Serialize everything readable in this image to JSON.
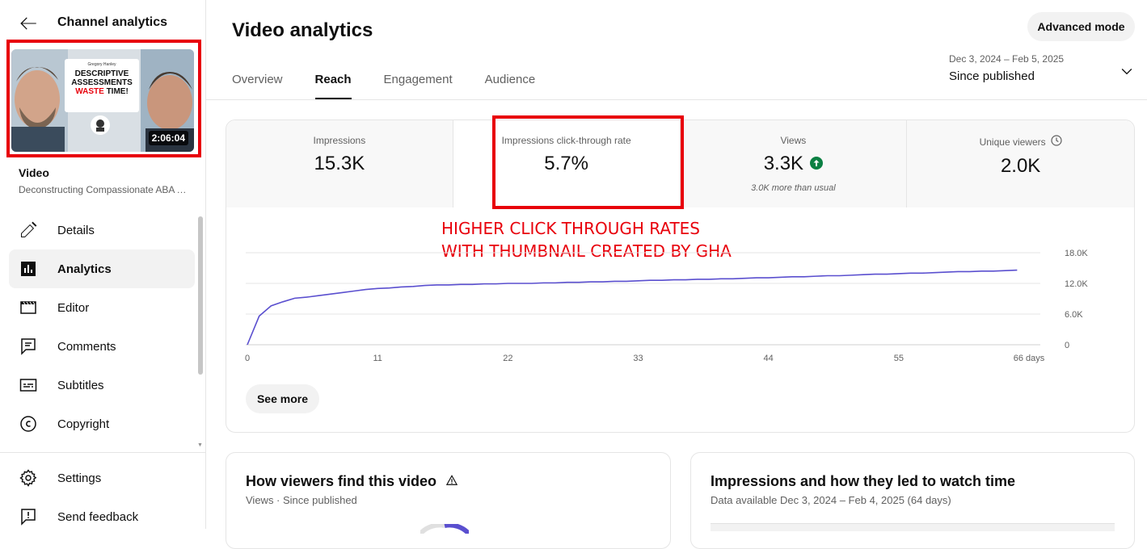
{
  "sidebar": {
    "title": "Channel analytics",
    "video_label": "Video",
    "video_name": "Deconstructing Compassionate ABA Assessments",
    "thumbnail": {
      "duration": "2:06:04",
      "author": "Gregory Hanley",
      "line1": "DESCRIPTIVE",
      "line2": "ASSESSMENTS",
      "line3a": "WASTE",
      "line3b": "TIME!"
    },
    "nav": [
      {
        "label": "Details",
        "icon": "pencil-icon"
      },
      {
        "label": "Analytics",
        "icon": "analytics-icon"
      },
      {
        "label": "Editor",
        "icon": "clapperboard-icon"
      },
      {
        "label": "Comments",
        "icon": "comment-icon"
      },
      {
        "label": "Subtitles",
        "icon": "subtitles-icon"
      },
      {
        "label": "Copyright",
        "icon": "copyright-icon"
      }
    ],
    "nav_bottom": [
      {
        "label": "Settings",
        "icon": "gear-icon"
      },
      {
        "label": "Send feedback",
        "icon": "feedback-icon"
      }
    ]
  },
  "header": {
    "title": "Video analytics",
    "advanced_mode": "Advanced mode",
    "tabs": [
      "Overview",
      "Reach",
      "Engagement",
      "Audience"
    ],
    "active_tab": "Reach",
    "date_range": "Dec 3, 2024 – Feb 5, 2025",
    "date_value": "Since published"
  },
  "metrics": [
    {
      "label": "Impressions",
      "value": "15.3K"
    },
    {
      "label": "Impressions click-through rate",
      "value": "5.7%"
    },
    {
      "label": "Views",
      "value": "3.3K",
      "sub": "3.0K more than usual"
    },
    {
      "label": "Unique viewers",
      "value": "2.0K"
    }
  ],
  "annotation": {
    "line1": "HIGHER CLICK THROUGH RATES",
    "line2": "WITH THUMBNAIL CREATED BY GHA"
  },
  "chart_data": {
    "type": "line",
    "series": [
      {
        "values": [
          0,
          5.6,
          7.6,
          8.4,
          9.1,
          9.3,
          9.6,
          9.9,
          10.2,
          10.5,
          10.8,
          11.0,
          11.1,
          11.3,
          11.4,
          11.6,
          11.7,
          11.7,
          11.8,
          11.8,
          11.9,
          11.9,
          12.0,
          12.0,
          12.0,
          12.1,
          12.1,
          12.2,
          12.2,
          12.3,
          12.3,
          12.4,
          12.4,
          12.5,
          12.6,
          12.6,
          12.7,
          12.7,
          12.8,
          12.8,
          12.9,
          12.9,
          13.0,
          13.1,
          13.1,
          13.2,
          13.3,
          13.3,
          13.4,
          13.5,
          13.5,
          13.6,
          13.7,
          13.8,
          13.8,
          13.9,
          14.0,
          14.0,
          14.1,
          14.2,
          14.3,
          14.3,
          14.4,
          14.4,
          14.5,
          14.6
        ]
      }
    ],
    "x_ticks": [
      "0",
      "11",
      "22",
      "33",
      "44",
      "55",
      "66 days"
    ],
    "y_ticks": [
      "0",
      "6.0K",
      "12.0K",
      "18.0K"
    ],
    "xlim": [
      0,
      66
    ],
    "ylim": [
      0,
      18
    ],
    "color": "#5a4fcf",
    "grid": true
  },
  "see_more": "See more",
  "cards": {
    "find": {
      "title": "How viewers find this video",
      "sub": "Views · Since published"
    },
    "impressions": {
      "title": "Impressions and how they led to watch time",
      "sub": "Data available Dec 3, 2024 – Feb 4, 2025 (64 days)"
    }
  },
  "colors": {
    "accent_red": "#e8000b",
    "line": "#5a4fcf",
    "up_badge": "#0b8043"
  }
}
